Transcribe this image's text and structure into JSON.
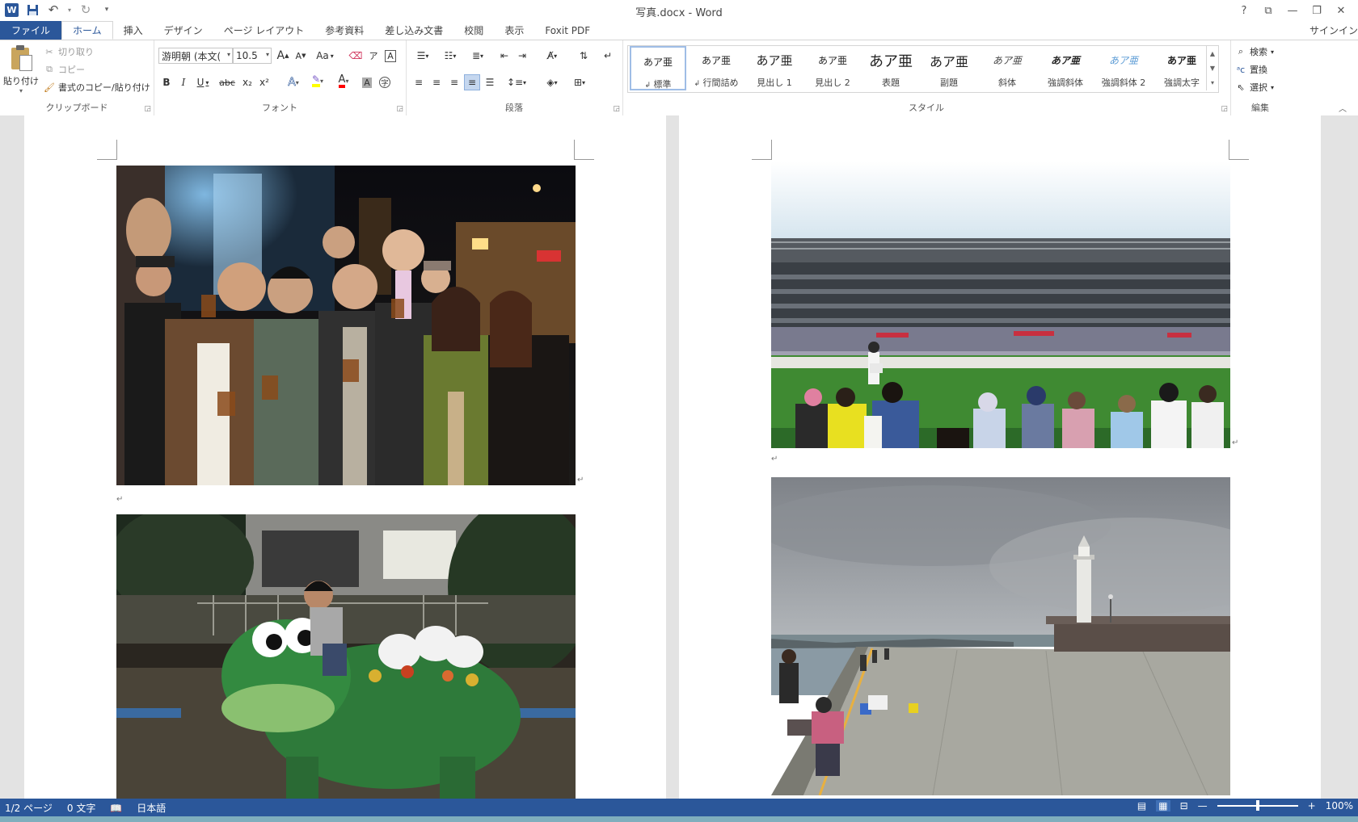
{
  "app": {
    "title": "写真.docx - Word",
    "signin": "サインイン"
  },
  "window_controls": {
    "help": "?",
    "ribbon_display": "⧉",
    "minimize": "—",
    "restore": "❐",
    "close": "✕"
  },
  "tabs": [
    "ファイル",
    "ホーム",
    "挿入",
    "デザイン",
    "ページ レイアウト",
    "参考資料",
    "差し込み文書",
    "校閲",
    "表示",
    "Foxit PDF"
  ],
  "clipboard": {
    "label": "クリップボード",
    "paste": "貼り付け",
    "cut": "切り取り",
    "copy": "コピー",
    "format_painter": "書式のコピー/貼り付け"
  },
  "font": {
    "label": "フォント",
    "name": "游明朝 (本文(",
    "size": "10.5",
    "grow": "A",
    "shrink": "A",
    "case": "Aa",
    "bold": "B",
    "italic": "I",
    "underline": "U",
    "strike": "abc",
    "subscript": "x₂",
    "superscript": "x²",
    "color_letter": "A"
  },
  "paragraph": {
    "label": "段落"
  },
  "styles": {
    "label": "スタイル",
    "items": [
      {
        "sample": "あア亜",
        "name": "標準"
      },
      {
        "sample": "あア亜",
        "name": "行間詰め"
      },
      {
        "sample": "あア亜",
        "name": "見出し 1"
      },
      {
        "sample": "あア亜",
        "name": "見出し 2"
      },
      {
        "sample": "あア亜",
        "name": "表題"
      },
      {
        "sample": "あア亜",
        "name": "副題"
      },
      {
        "sample": "あア亜",
        "name": "斜体"
      },
      {
        "sample": "あア亜",
        "name": "強調斜体"
      },
      {
        "sample": "あア亜",
        "name": "強調斜体 2"
      },
      {
        "sample": "あア亜",
        "name": "強調太字"
      }
    ]
  },
  "editing": {
    "label": "編集",
    "find": "検索",
    "replace": "置換",
    "select": "選択"
  },
  "status": {
    "page": "1/2 ページ",
    "words": "0 文字",
    "language": "日本語",
    "zoom": "100%",
    "zoom_level": 0.5
  },
  "colors": {
    "accent": "#2b579a",
    "highlight": "#ffff00",
    "font_color": "#ff0000"
  }
}
